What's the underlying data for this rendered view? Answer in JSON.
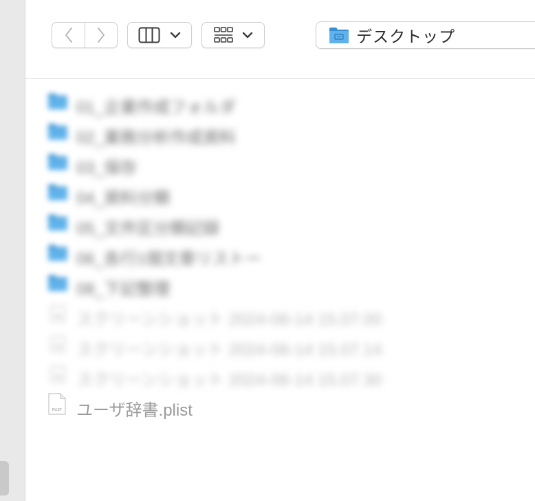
{
  "window": {
    "location_label": "デスクトップ"
  },
  "toolbar": {
    "back_label": "<",
    "forward_label": ">"
  },
  "files": [
    {
      "name": "01_企業作成フォルダ",
      "kind": "folder",
      "blurred": true
    },
    {
      "name": "02_業務分析作成資料",
      "kind": "folder",
      "blurred": true
    },
    {
      "name": "03_保存",
      "kind": "folder",
      "blurred": true
    },
    {
      "name": "04_資料分類",
      "kind": "folder",
      "blurred": true
    },
    {
      "name": "05_文件区分類記録",
      "kind": "folder",
      "blurred": true
    },
    {
      "name": "06_各行1個文章リストー",
      "kind": "folder",
      "blurred": true
    },
    {
      "name": "08_下記整理",
      "kind": "folder",
      "blurred": true
    },
    {
      "name": "スクリーンショット 2024-06-14 15.07.00",
      "kind": "image",
      "blurred": true
    },
    {
      "name": "スクリーンショット 2024-06-14 15.07.14",
      "kind": "image",
      "blurred": true
    },
    {
      "name": "スクリーンショット 2024-06-14 15.07.30",
      "kind": "image",
      "blurred": true
    },
    {
      "name": "ユーザ辞書.plist",
      "kind": "plist",
      "blurred": false,
      "icon_text": "PLIST"
    }
  ],
  "colors": {
    "folder": "#5fb2ea",
    "folder_dark": "#3a8fd0",
    "text_primary": "#2b2b2b",
    "text_secondary": "#9a9a9a",
    "sidebar_bg": "#e9e9e9"
  }
}
